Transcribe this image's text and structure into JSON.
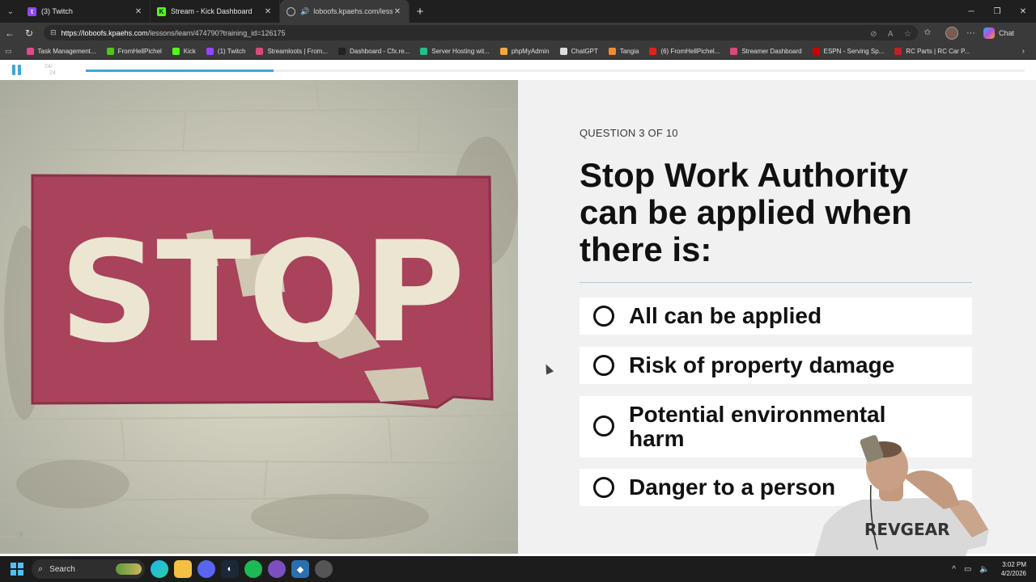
{
  "browser": {
    "tabs": [
      {
        "label": "(3) Twitch",
        "icon": "twitch-icon",
        "color": "#9146ff"
      },
      {
        "label": "Stream - Kick Dashboard",
        "icon": "kick-icon",
        "color": "#53fc18"
      },
      {
        "label": "loboofs.kpaehs.com/lessons/l",
        "icon": "globe-icon",
        "color": "#aaaaaa"
      }
    ],
    "url_host": "https://loboofs.kpaehs.com",
    "url_path": "/lessons/learn/474790?training_id=126175",
    "copilot_label": "Chat",
    "bookmarks": [
      {
        "label": "Task Management...",
        "color": "#e04a8c"
      },
      {
        "label": "FromHellPichel",
        "color": "#53c41a"
      },
      {
        "label": "Kick",
        "color": "#53fc18"
      },
      {
        "label": "(1) Twitch",
        "color": "#9146ff"
      },
      {
        "label": "Streamloots | From...",
        "color": "#d94a7a"
      },
      {
        "label": "Dashboard - Cfx.re...",
        "color": "#222222"
      },
      {
        "label": "Server Hosting wit...",
        "color": "#22c08a"
      },
      {
        "label": "phpMyAdmin",
        "color": "#f4a640"
      },
      {
        "label": "ChatGPT",
        "color": "#dddddd"
      },
      {
        "label": "Tangia",
        "color": "#f28c28"
      },
      {
        "label": "(6) FromHellPichel...",
        "color": "#e62117"
      },
      {
        "label": "Streamer Dashboard",
        "color": "#d94a7a"
      },
      {
        "label": "ESPN - Serving Sp...",
        "color": "#d00000"
      },
      {
        "label": "RC Parts | RC Car P...",
        "color": "#c0202a"
      }
    ]
  },
  "player": {
    "page_current": "24",
    "page_total": "24",
    "progress_fraction": 0.2,
    "accent_color": "#3ea7d6"
  },
  "image_panel": {
    "sign_text": "STOP"
  },
  "question": {
    "counter": "QUESTION 3 OF 10",
    "title": "Stop Work Authority can be applied when there is:",
    "options": [
      {
        "label": "All can be applied"
      },
      {
        "label": "Risk of property damage"
      },
      {
        "label": "Potential environmental harm"
      },
      {
        "label": "Danger to a person"
      }
    ]
  },
  "webcam": {
    "shirt_text": "REVGEAR"
  },
  "taskbar": {
    "search_label": "Search",
    "time": "3:02 PM",
    "date": "4/2/2026"
  }
}
